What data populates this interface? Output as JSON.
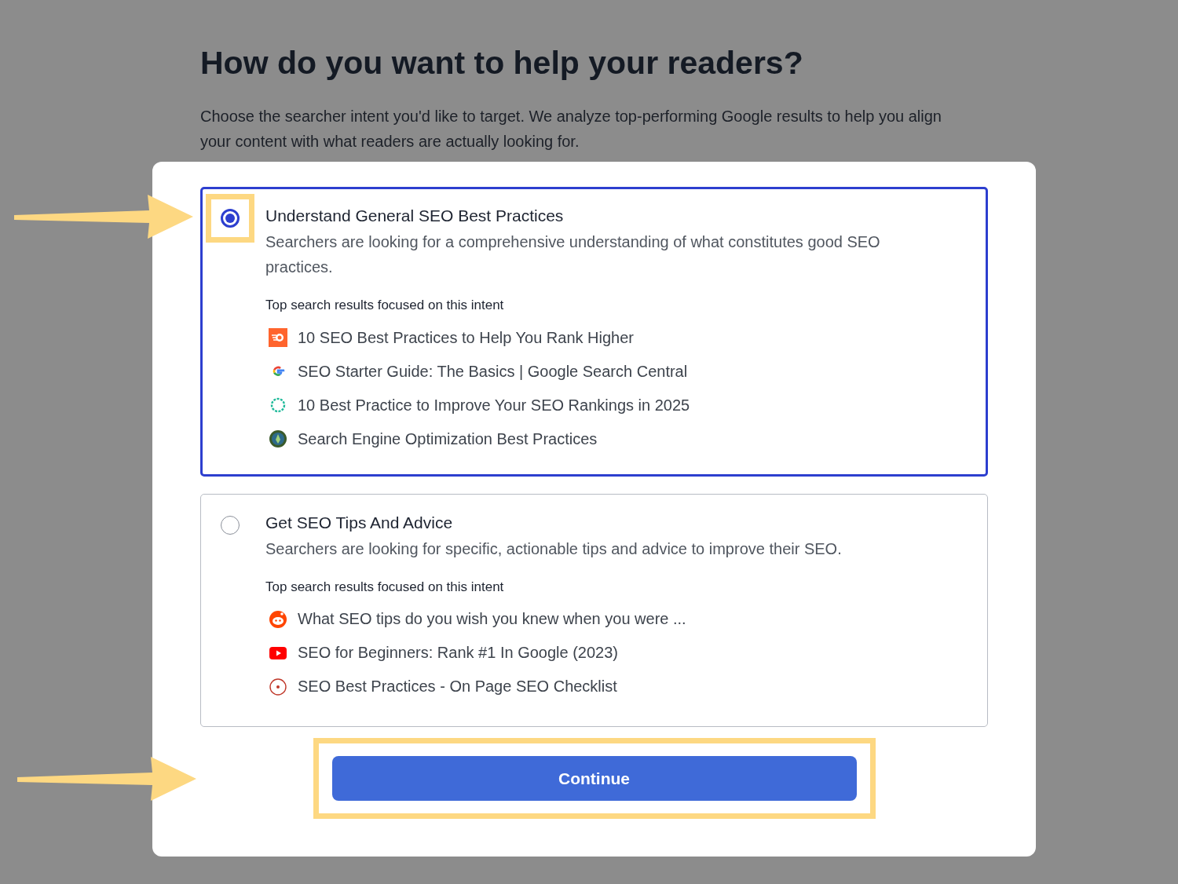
{
  "heading": "How do you want to help your readers?",
  "intro": "Choose the searcher intent you'd like to target. We analyze top-performing Google results to help you align your content with what readers are actually looking for.",
  "options": [
    {
      "title": "Understand General SEO Best Practices",
      "selected": true,
      "highlighted": true,
      "description": "Searchers are looking for a comprehensive understanding of what constitutes good SEO practices.",
      "results_label": "Top search results focused on this intent",
      "results": [
        {
          "kind": "flame",
          "title": "10 SEO Best Practices to Help You Rank Higher"
        },
        {
          "kind": "g",
          "title": "SEO Starter Guide: The Basics | Google Search Central"
        },
        {
          "kind": "ring",
          "title": "10 Best Practice to Improve Your SEO Rankings in 2025"
        },
        {
          "kind": "seal",
          "title": "Search Engine Optimization Best Practices"
        }
      ]
    },
    {
      "title": "Get SEO Tips And Advice",
      "selected": false,
      "highlighted": false,
      "description": "Searchers are looking for specific, actionable tips and advice to improve their SEO.",
      "results_label": "Top search results focused on this intent",
      "results": [
        {
          "kind": "face",
          "title": "What SEO tips do you wish you knew when you were ..."
        },
        {
          "kind": "play",
          "title": "SEO for Beginners: Rank #1 In Google (2023)"
        },
        {
          "kind": "target",
          "title": "SEO Best Practices - On Page SEO Checklist"
        }
      ]
    }
  ],
  "continue_button": {
    "label": "Continue",
    "highlighted": true
  }
}
